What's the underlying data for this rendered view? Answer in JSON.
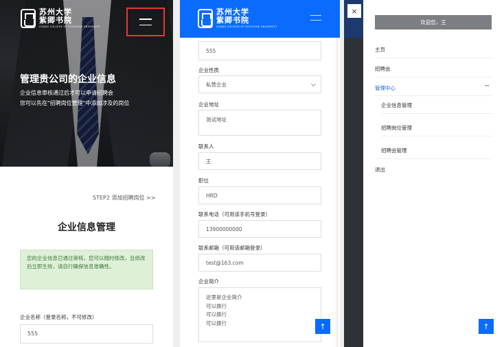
{
  "brand": {
    "name_line1": "苏州大学",
    "name_line2": "紫卿书院",
    "name_en": "ZIQING COLLEGE OF SOOCHOW UNIVERSITY"
  },
  "panel1": {
    "hero_title": "管理贵公司的企业信息",
    "hero_line1": "企业信息审核通过后才可以申请招聘会",
    "hero_line2": "您可以先在\"招聘岗位管理\"中添加涉及的岗位",
    "step_link": "STEP2 添加招聘岗位 >>",
    "section_title": "企业信息管理",
    "alert": "您的企业信息已通过审核，您可以随时修改，且修改后立即生效，请自行确保信息准确性。",
    "company_name_label": "企业名称（登录名称，不可修改）",
    "company_name_value": "555"
  },
  "panel2": {
    "company_name_value": "555",
    "nature_label": "企业性质",
    "nature_value": "私营企业",
    "address_label": "企业地址",
    "address_value": "测试地址",
    "contact_label": "联系人",
    "contact_value": "王",
    "position_label": "职位",
    "position_value": "HRD",
    "phone_label": "联系电话（可用该手机号登录）",
    "phone_value": "13900000000",
    "email_label": "联系邮箱（可用该邮箱登录）",
    "email_value": "test@163.com",
    "intro_label": "企业简介",
    "intro_lines": [
      "这里是企业简介",
      "可以换行",
      "可以换行",
      "可以换行"
    ]
  },
  "panel3": {
    "close": "×",
    "welcome": "欢迎您，王",
    "nav": {
      "home": "主页",
      "fair": "招聘会",
      "manage": "管理中心",
      "collapse": "−",
      "sub_company": "企业信息管理",
      "sub_jobs": "招聘岗位管理",
      "sub_fair": "招聘会管理",
      "logout": "退出"
    }
  },
  "totop": "↑",
  "colors": {
    "primary_blue": "#0a6cff",
    "alert_bg": "#dff0d8",
    "alert_text": "#3c763d",
    "highlight_red": "#e53935",
    "welcome_bg": "#7b7e82"
  }
}
